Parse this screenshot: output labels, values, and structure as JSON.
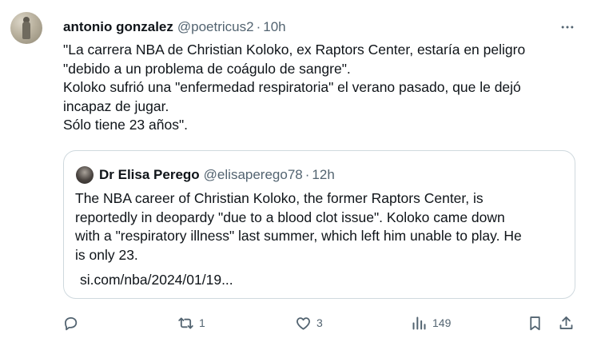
{
  "tweet": {
    "author_name": "antonio gonzalez",
    "author_handle": "@poetricus2",
    "separator": "·",
    "time": "10h",
    "text_lines": [
      "\"La carrera NBA de Christian Koloko, ex Raptors Center, estaría en peligro",
      "\"debido a un problema de coágulo de sangre\".",
      "Koloko sufrió una \"enfermedad respiratoria\" el verano pasado, que le dejó",
      "incapaz de jugar.",
      "Sólo tiene 23 años\"."
    ]
  },
  "quote": {
    "author_name": "Dr Elisa Perego",
    "author_handle": "@elisaperego78",
    "separator": "·",
    "time": "12h",
    "text_lines": [
      "The NBA career of Christian Koloko, the former Raptors Center, is",
      "reportedly in deopardy \"due to a blood clot issue\". Koloko came down",
      "with a \"respiratory illness\" last summer, which left him unable to play. He",
      "is only 23."
    ],
    "link": "si.com/nba/2024/01/19..."
  },
  "actions": {
    "reply_count": "",
    "retweet_count": "1",
    "like_count": "3",
    "views_count": "149"
  },
  "icons": {
    "more": "more-dots-icon",
    "reply": "reply-bubble-icon",
    "retweet": "retweet-icon",
    "like": "heart-icon",
    "views": "views-bar-chart-icon",
    "bookmark": "bookmark-icon",
    "share": "share-upload-icon"
  },
  "colors": {
    "text": "#0f1419",
    "secondary": "#536471",
    "border": "#cfd9de"
  }
}
